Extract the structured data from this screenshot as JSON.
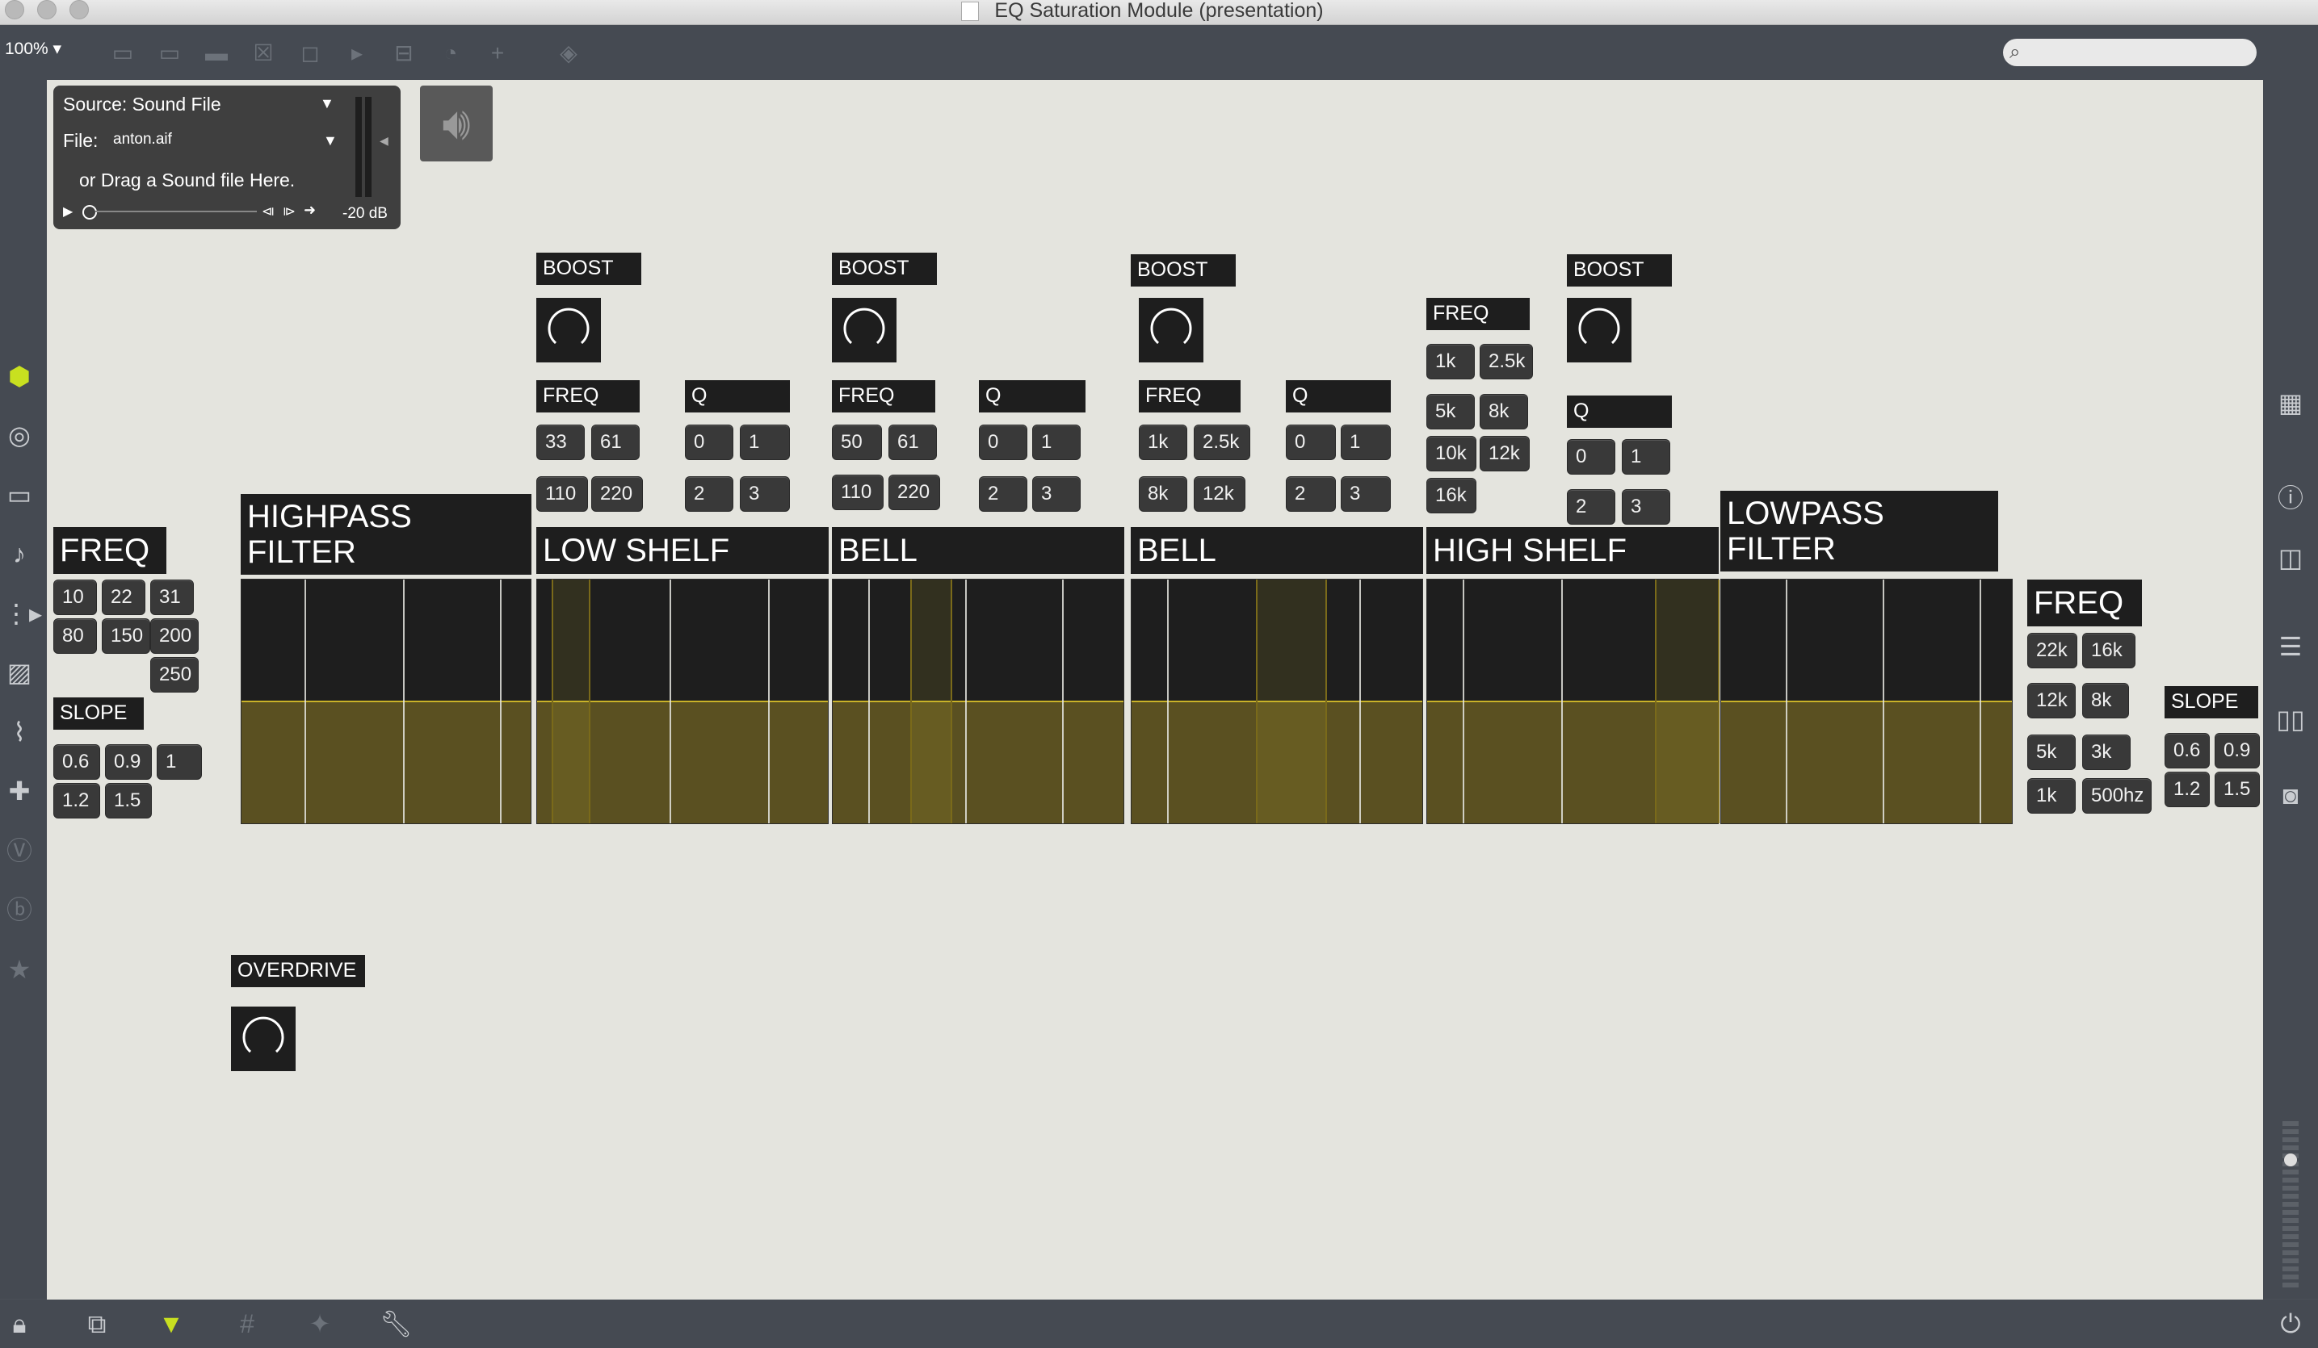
{
  "window": {
    "title": "EQ Saturation Module (presentation)"
  },
  "toolbar": {
    "zoom": "100% ▾",
    "search_placeholder": ""
  },
  "source": {
    "source_label": "Source: Sound File",
    "file_label": "File:",
    "file_name": "anton.aif",
    "drag_hint": "or Drag a Sound file Here.",
    "level": "-20 dB"
  },
  "highpass": {
    "title": "HIGHPASS\nFILTER",
    "freq_label": "FREQ",
    "freq_buttons": [
      "10",
      "22",
      "31",
      "80",
      "150",
      "200",
      "250"
    ],
    "slope_label": "SLOPE",
    "slope_buttons": [
      "0.6",
      "0.9",
      "1",
      "1.2",
      "1.5"
    ]
  },
  "low_shelf": {
    "title": "LOW SHELF",
    "boost_label": "BOOST",
    "freq_label": "FREQ",
    "freq_buttons": [
      "33",
      "61",
      "110",
      "220"
    ],
    "q_label": "Q",
    "q_buttons": [
      "0",
      "1",
      "2",
      "3"
    ]
  },
  "bell1": {
    "title": "BELL",
    "boost_label": "BOOST",
    "freq_label": "FREQ",
    "freq_buttons": [
      "50",
      "61",
      "110",
      "220"
    ],
    "q_label": "Q",
    "q_buttons": [
      "0",
      "1",
      "2",
      "3"
    ]
  },
  "bell2": {
    "title": "BELL",
    "boost_label": "BOOST",
    "freq_label": "FREQ",
    "freq_buttons": [
      "1k",
      "2.5k",
      "8k",
      "12k"
    ],
    "q_label": "Q",
    "q_buttons": [
      "0",
      "1",
      "2",
      "3"
    ]
  },
  "high_shelf": {
    "title": "HIGH SHELF",
    "boost_label": "BOOST",
    "freq_label": "FREQ",
    "freq_buttons": [
      "1k",
      "2.5k",
      "5k",
      "8k",
      "10k",
      "12k",
      "16k"
    ],
    "q_label": "Q",
    "q_buttons": [
      "0",
      "1",
      "2",
      "3"
    ]
  },
  "lowpass": {
    "title": "LOWPASS\nFILTER",
    "freq_label": "FREQ",
    "freq_buttons": [
      "22k",
      "16k",
      "12k",
      "8k",
      "5k",
      "3k",
      "1k",
      "500hz"
    ],
    "slope_label": "SLOPE",
    "slope_buttons": [
      "0.6",
      "0.9",
      "1.2",
      "1.5"
    ]
  },
  "overdrive": {
    "label": "OVERDRIVE"
  },
  "colors": {
    "canvas": "#e4e4de",
    "panel": "#1e1e1e",
    "eq_fill": "#5a5021",
    "eq_line": "#c9b228",
    "accent": "#c8e020"
  }
}
